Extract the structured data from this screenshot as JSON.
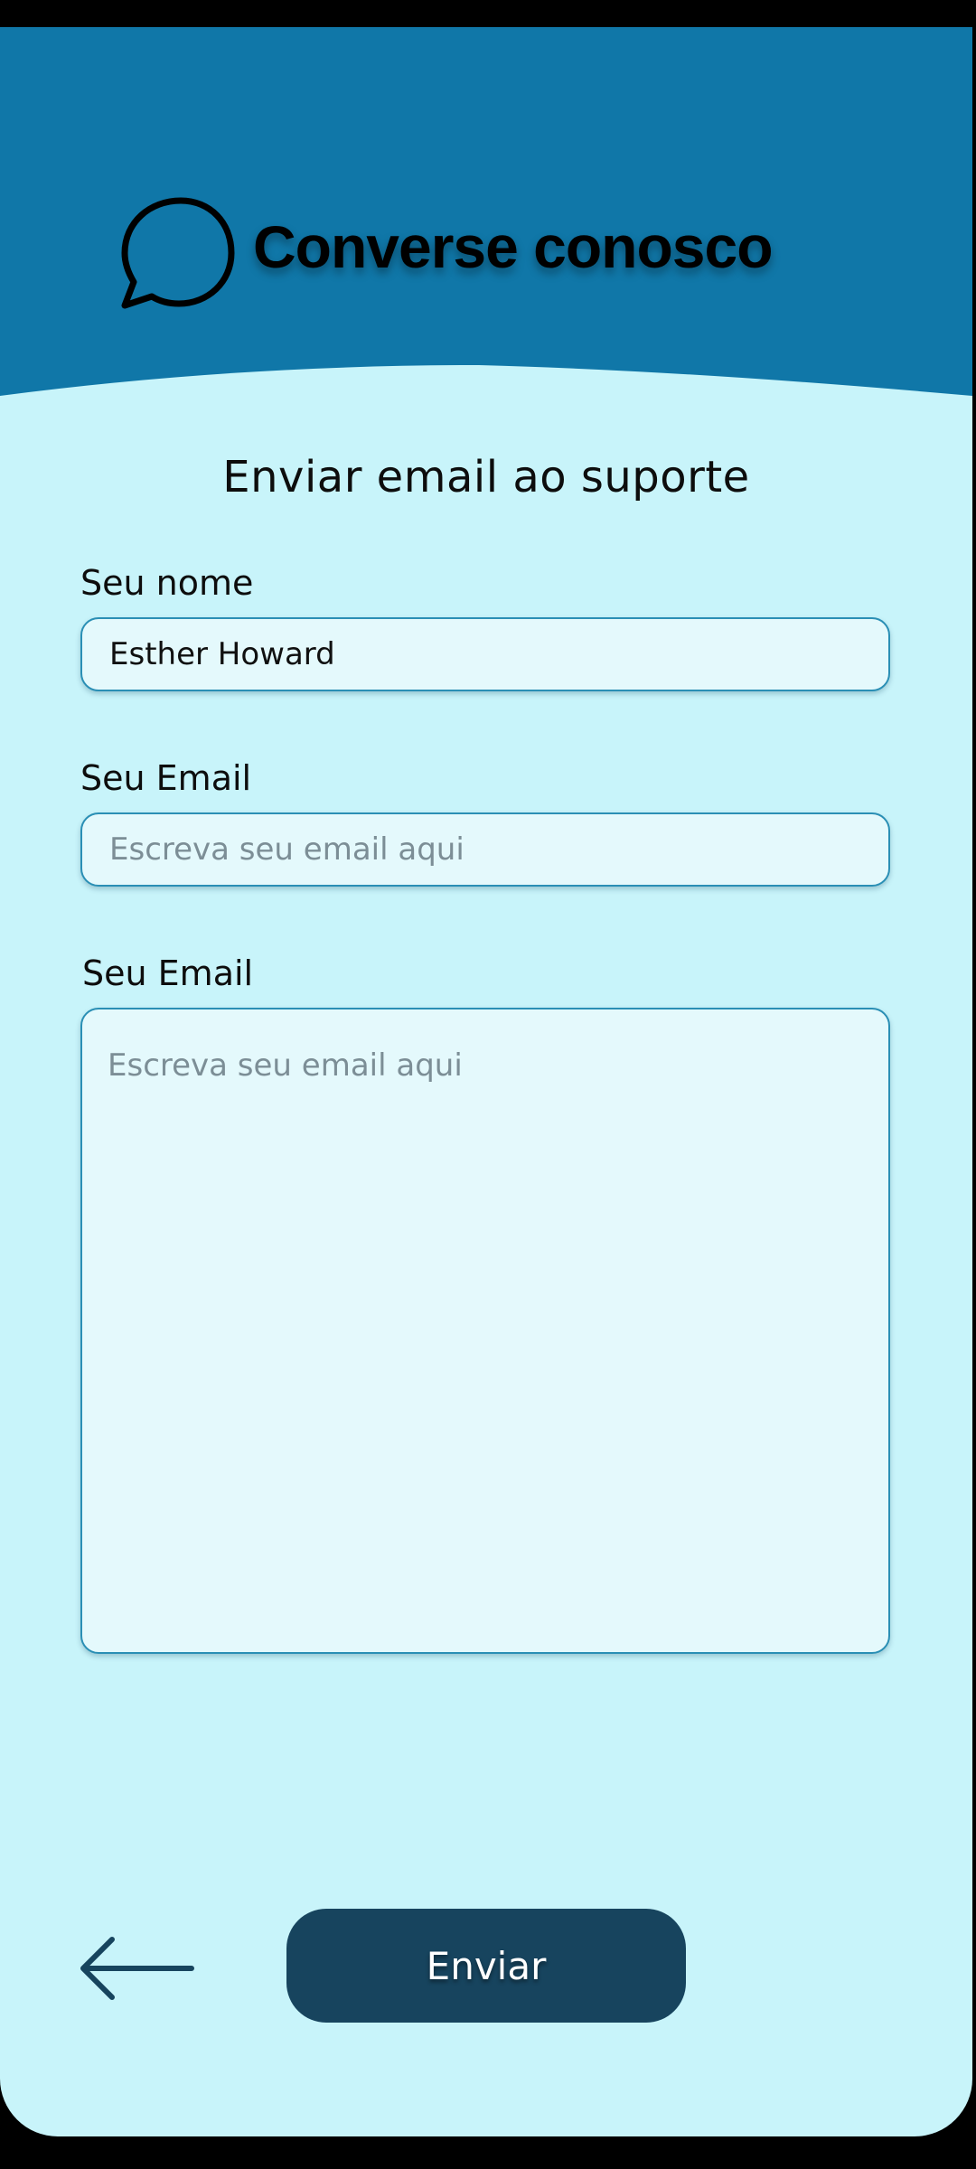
{
  "header": {
    "title": "Converse conosco",
    "icon": "chat-bubble-icon",
    "background_color": "#1077a8"
  },
  "page": {
    "title": "Enviar email ao suporte",
    "background_color": "#c8f4fa"
  },
  "form": {
    "name": {
      "label": "Seu nome",
      "value": "Esther Howard",
      "placeholder": ""
    },
    "email": {
      "label": "Seu Email",
      "value": "",
      "placeholder": "Escreva seu email aqui"
    },
    "message": {
      "label": "Seu Email",
      "value": "",
      "placeholder": "Escreva seu email aqui"
    }
  },
  "actions": {
    "back_icon": "arrow-left-icon",
    "send_label": "Enviar",
    "send_color": "#17445e"
  }
}
